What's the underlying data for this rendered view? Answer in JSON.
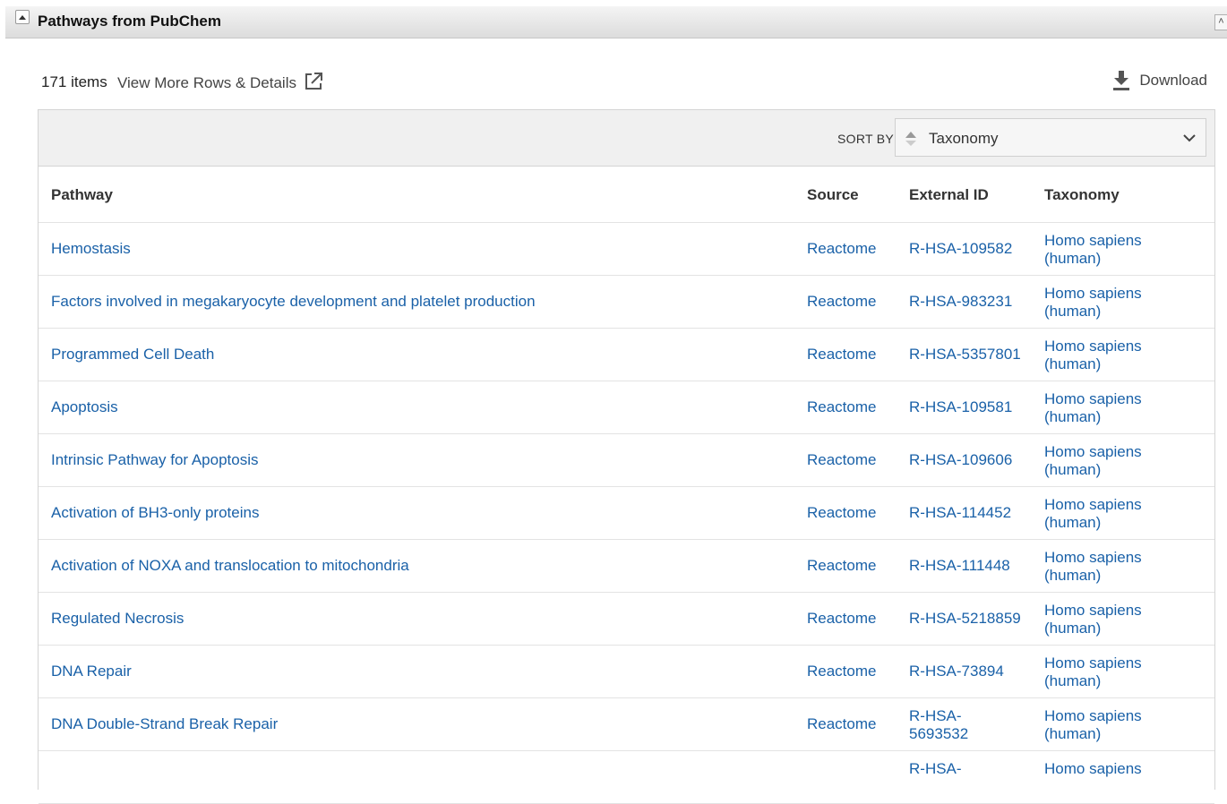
{
  "section": {
    "title": "Pathways from PubChem",
    "collapse_icon": "triangle-up-icon",
    "scroll_top_icon": "double-chevron-up-icon"
  },
  "toolbar": {
    "item_count": "171 items",
    "view_more": "View More Rows & Details",
    "view_more_icon": "external-link-icon",
    "download": "Download",
    "download_icon": "download-icon"
  },
  "sort": {
    "label": "SORT BY",
    "value": "Taxonomy"
  },
  "columns": [
    "Pathway",
    "Source",
    "External ID",
    "Taxonomy"
  ],
  "rows": [
    {
      "pathway": "Hemostasis",
      "source": "Reactome",
      "external_id": "R-HSA-109582",
      "taxonomy": "Homo sapiens (human)"
    },
    {
      "pathway": "Factors involved in megakaryocyte development and platelet production",
      "source": "Reactome",
      "external_id": "R-HSA-983231",
      "taxonomy": "Homo sapiens (human)"
    },
    {
      "pathway": "Programmed Cell Death",
      "source": "Reactome",
      "external_id": "R-HSA-5357801",
      "taxonomy": "Homo sapiens (human)"
    },
    {
      "pathway": "Apoptosis",
      "source": "Reactome",
      "external_id": "R-HSA-109581",
      "taxonomy": "Homo sapiens (human)"
    },
    {
      "pathway": "Intrinsic Pathway for Apoptosis",
      "source": "Reactome",
      "external_id": "R-HSA-109606",
      "taxonomy": "Homo sapiens (human)"
    },
    {
      "pathway": "Activation of BH3-only proteins",
      "source": "Reactome",
      "external_id": "R-HSA-114452",
      "taxonomy": "Homo sapiens (human)"
    },
    {
      "pathway": "Activation of NOXA and translocation to mitochondria",
      "source": "Reactome",
      "external_id": "R-HSA-111448",
      "taxonomy": "Homo sapiens (human)"
    },
    {
      "pathway": "Regulated Necrosis",
      "source": "Reactome",
      "external_id": "R-HSA-5218859",
      "taxonomy": "Homo sapiens (human)"
    },
    {
      "pathway": "DNA Repair",
      "source": "Reactome",
      "external_id": "R-HSA-73894",
      "taxonomy": "Homo sapiens (human)"
    },
    {
      "pathway": "DNA Double-Strand Break Repair",
      "source": "Reactome",
      "external_id": "R-HSA-5693532",
      "taxonomy": "Homo sapiens (human)"
    },
    {
      "pathway": "",
      "source": "",
      "external_id": "R-HSA-",
      "taxonomy": "Homo sapiens"
    }
  ],
  "colors": {
    "link": "#1a61a8",
    "header_bg": "#dcdcdc",
    "sortbar_bg": "#f0f0f0"
  }
}
